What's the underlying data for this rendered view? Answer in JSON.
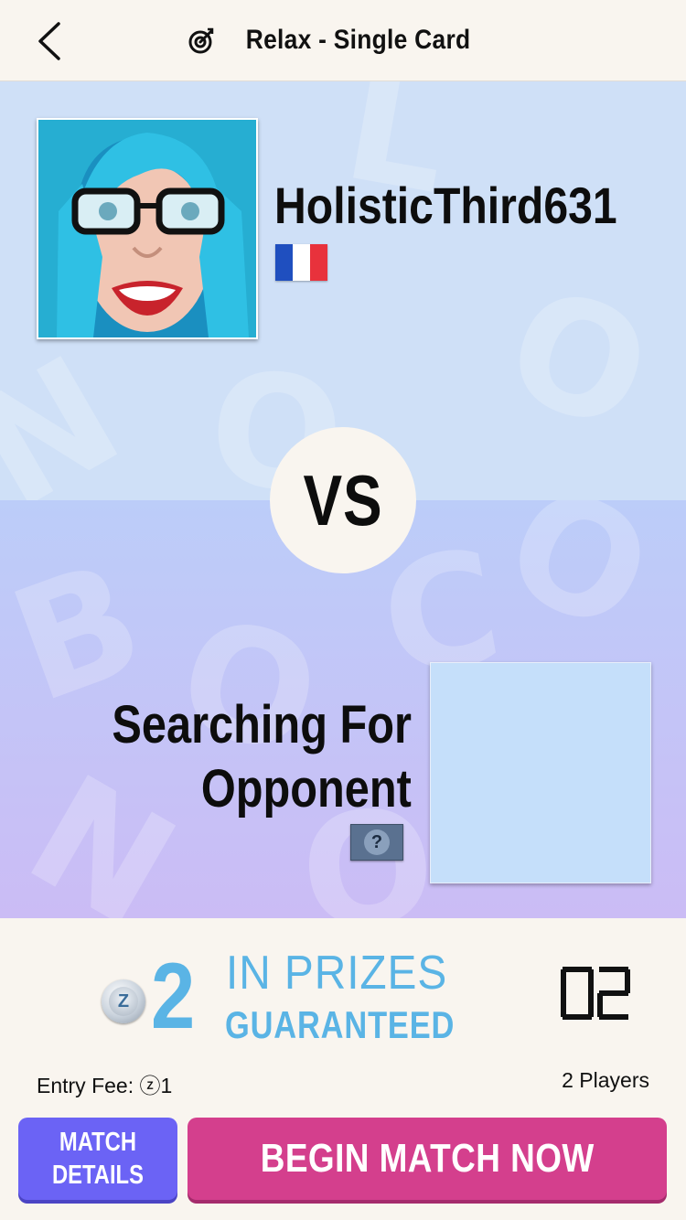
{
  "header": {
    "title": "Relax - Single Card",
    "back_icon": "chevron-left-icon",
    "mode_icon": "target-icon"
  },
  "player": {
    "username": "HolisticThird631",
    "country_flag": "france-flag",
    "flag_colors": [
      "#1f4fbf",
      "#ffffff",
      "#e8323c"
    ]
  },
  "versus": {
    "label": "VS"
  },
  "opponent": {
    "status_line1": "Searching For",
    "status_line2": "Opponent",
    "help_label": "?"
  },
  "prize": {
    "coin_symbol": "Z",
    "amount": "2",
    "line1": "IN PRIZES",
    "line2": "GUARANTEED",
    "timer": "02"
  },
  "info": {
    "entry_fee": "Entry Fee: ⓩ1",
    "players": "2 Players"
  },
  "buttons": {
    "match_details": "MATCH\nDETAILS",
    "begin_match": "BEGIN MATCH NOW"
  },
  "colors": {
    "accent_blue": "#5ab4e5",
    "details_button": "#6b63f5",
    "begin_button": "#d43f8d",
    "top_panel": "#cfe0f7",
    "bottom_panel": "#c4c3f7"
  }
}
